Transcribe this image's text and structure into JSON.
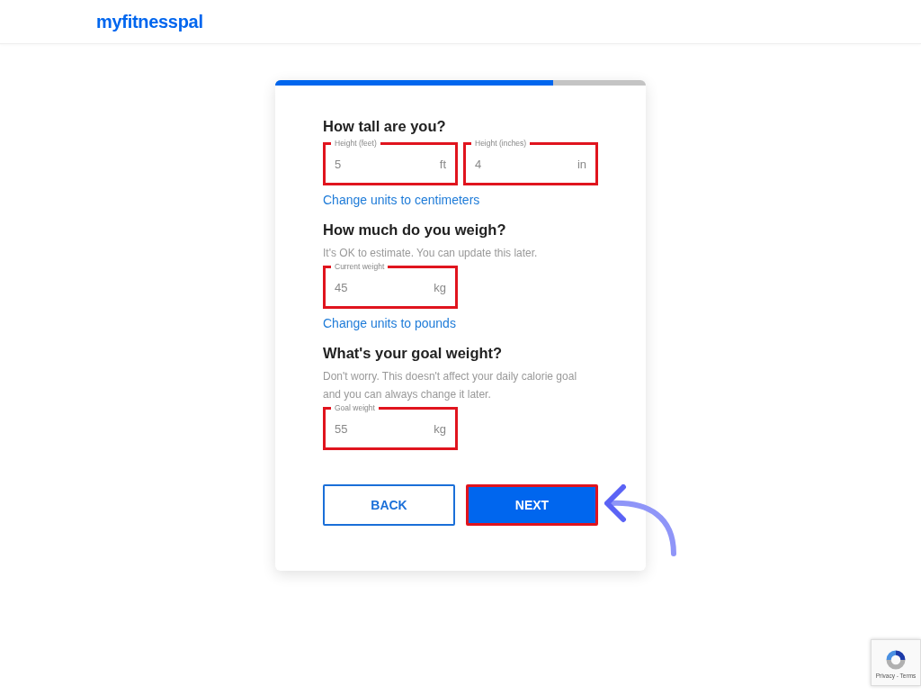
{
  "header": {
    "logo": "myfitnesspal"
  },
  "progress": {
    "level": 0.75
  },
  "sections": [
    {
      "heading": "How tall are you?",
      "fields": [
        {
          "label": "Height (feet)",
          "value": "5",
          "unit": "ft",
          "highlighted": true
        },
        {
          "label": "Height (inches)",
          "value": "4",
          "unit": "in",
          "highlighted": true
        }
      ],
      "link": "Change units to centimeters"
    },
    {
      "heading": "How much do you weigh?",
      "hint": "It's OK to estimate. You can update this later.",
      "fields": [
        {
          "label": "Current weight",
          "value": "45",
          "unit": "kg",
          "highlighted": true
        }
      ],
      "link": "Change units to pounds"
    },
    {
      "heading": "What's your goal weight?",
      "hint": "Don't worry. This doesn't affect your daily calorie goal and you can always change it later.",
      "fields": [
        {
          "label": "Goal weight",
          "value": "55",
          "unit": "kg",
          "highlighted": true
        }
      ]
    }
  ],
  "buttons": [
    {
      "kind": "secondary",
      "label": "BACK",
      "highlighted": false
    },
    {
      "kind": "primary",
      "label": "NEXT",
      "highlighted": true
    }
  ],
  "recaptcha": {
    "links": "Privacy - Terms"
  }
}
